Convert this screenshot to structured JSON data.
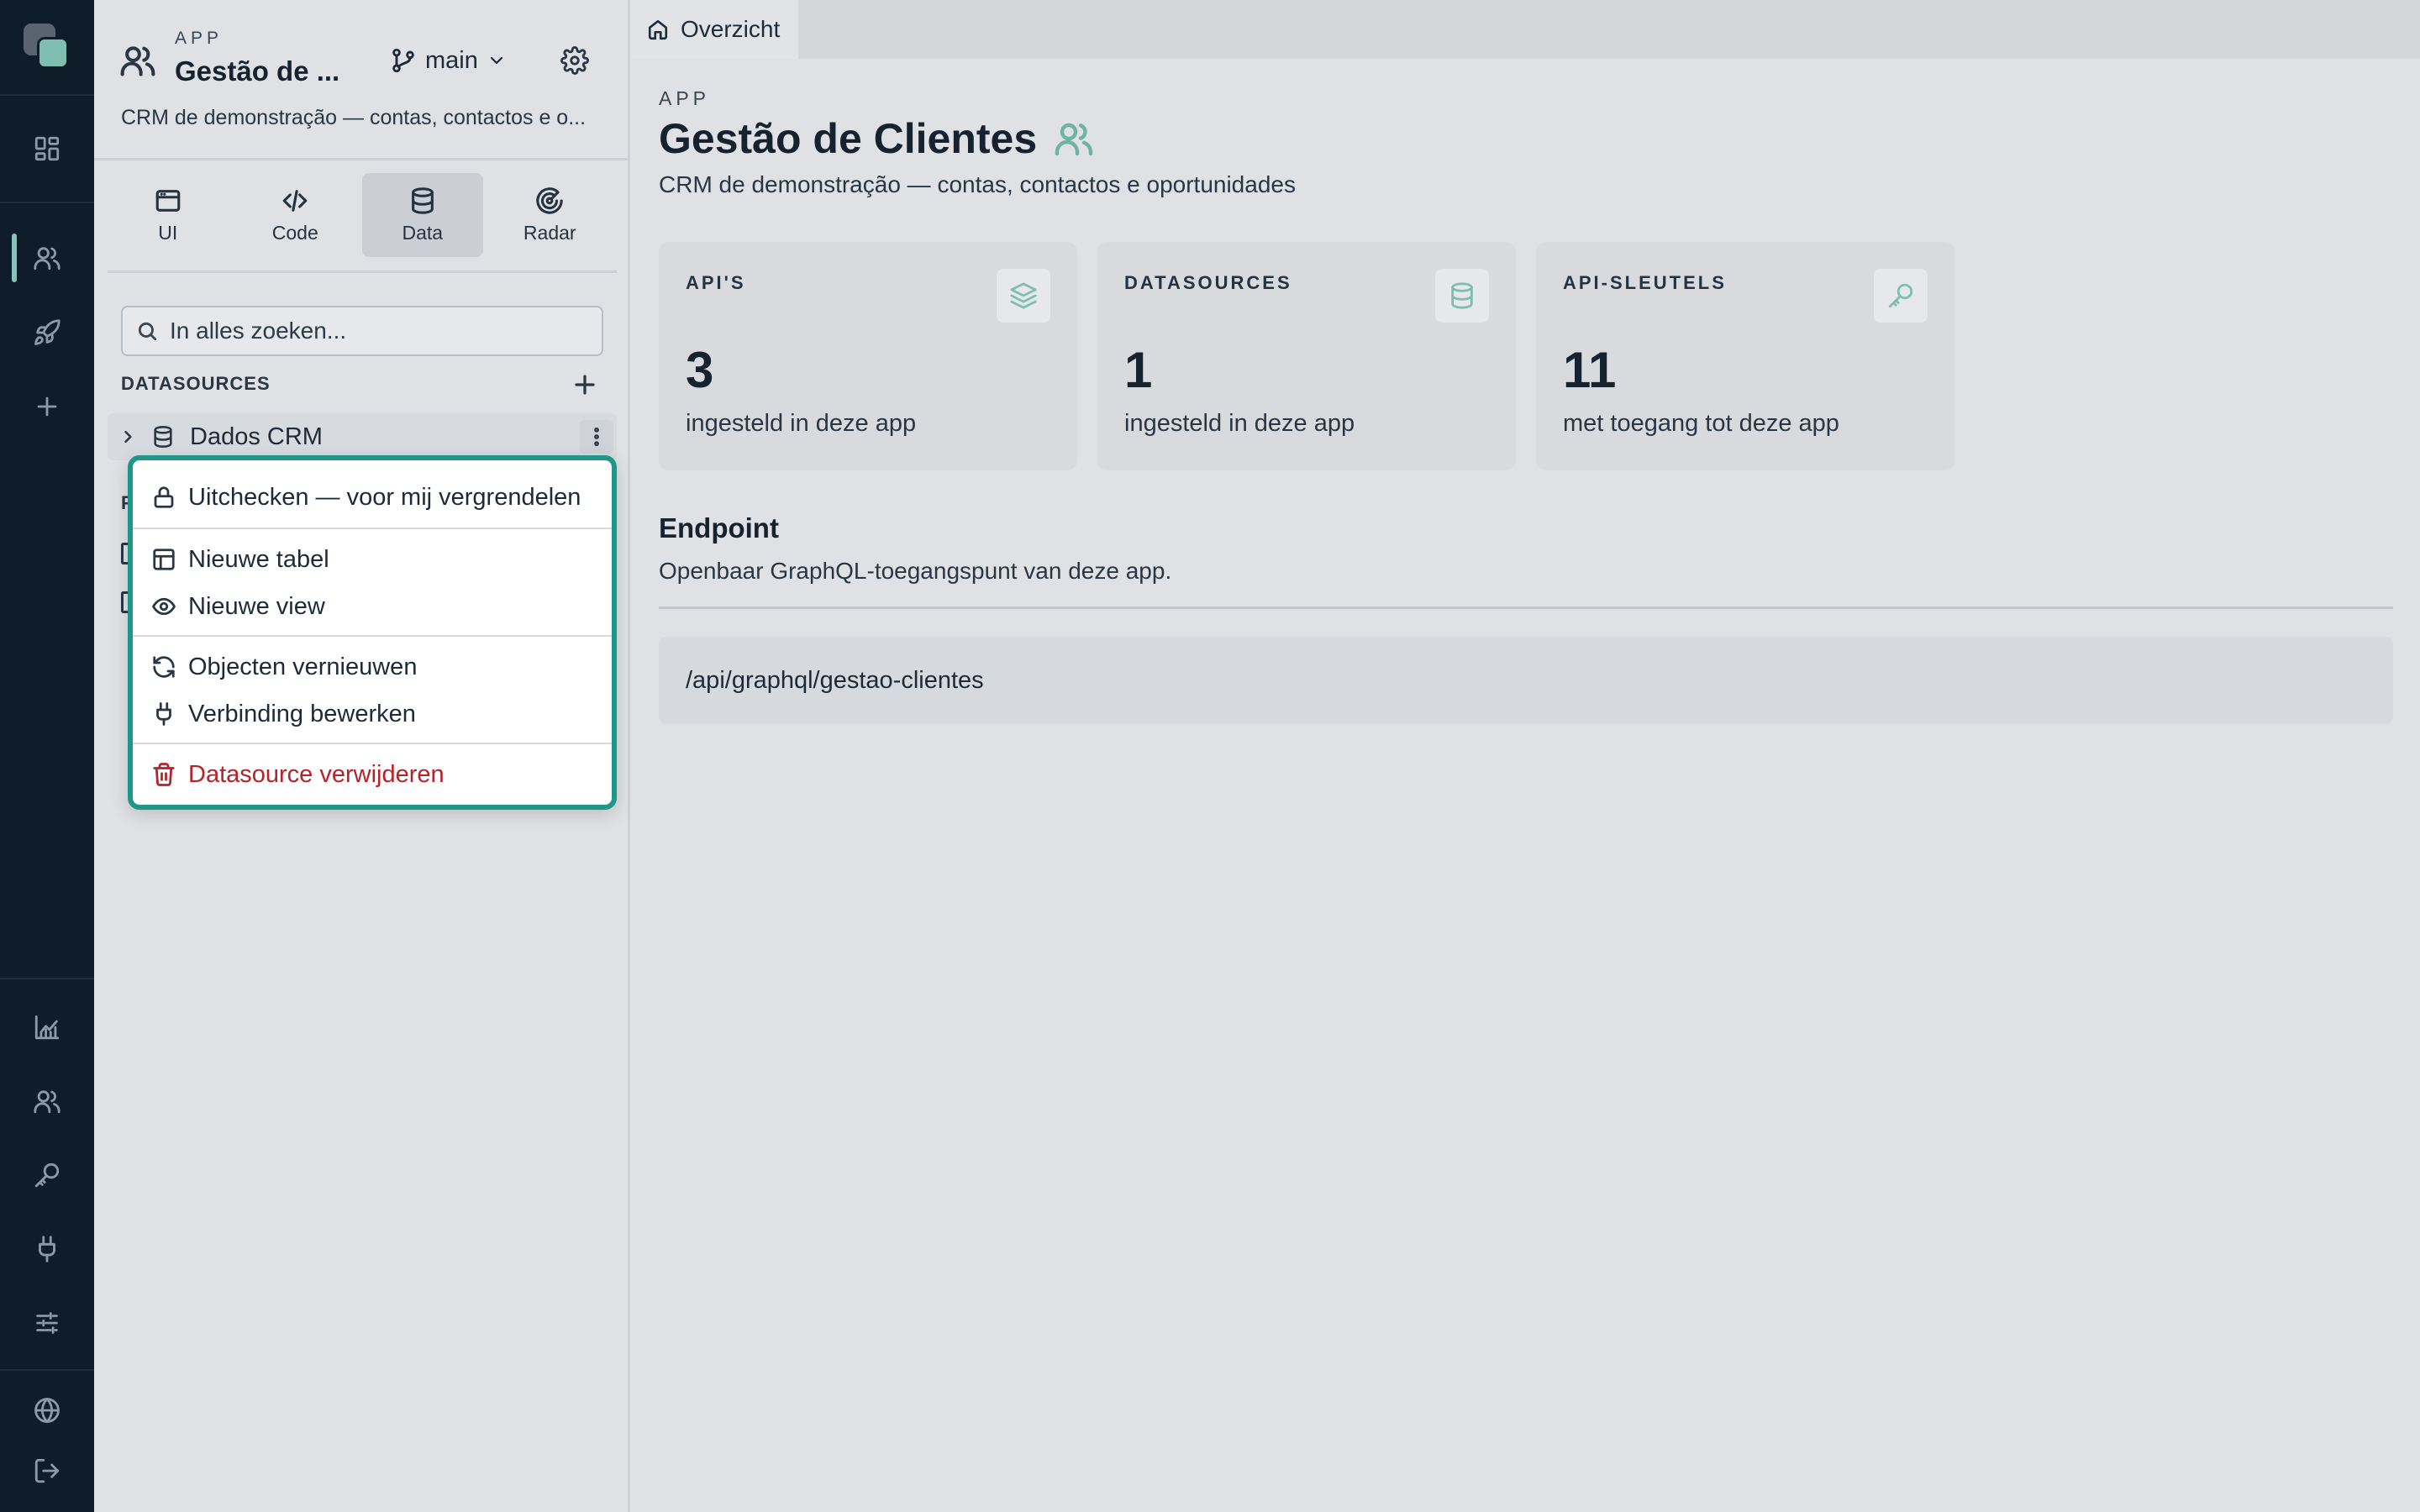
{
  "panel": {
    "kicker": "APP",
    "title": "Gestão de ...",
    "description": "CRM de demonstração — contas, contactos e o...",
    "branch": "main",
    "tabs": [
      {
        "label": "UI",
        "icon": "window-icon"
      },
      {
        "label": "Code",
        "icon": "code-icon"
      },
      {
        "label": "Data",
        "icon": "database-icon",
        "active": true
      },
      {
        "label": "Radar",
        "icon": "radar-icon"
      }
    ],
    "search_placeholder": "In alles zoeken...",
    "datasources_title": "DATASOURCES",
    "datasource_item": "Dados CRM",
    "section_peek": "P"
  },
  "menu": {
    "items": [
      {
        "label": "Uitchecken — voor mij vergrendelen",
        "icon": "lock-icon"
      },
      {
        "label": "Nieuwe tabel",
        "icon": "table-icon"
      },
      {
        "label": "Nieuwe view",
        "icon": "eye-icon"
      },
      {
        "label": "Objecten vernieuwen",
        "icon": "refresh-icon"
      },
      {
        "label": "Verbinding bewerken",
        "icon": "plug-icon"
      },
      {
        "label": "Datasource verwijderen",
        "icon": "trash-icon",
        "danger": true
      }
    ]
  },
  "main": {
    "tab": "Overzicht",
    "kicker": "APP",
    "title": "Gestão de Clientes",
    "description": "CRM de demonstração — contas, contactos e oportunidades",
    "cards": [
      {
        "label": "API'S",
        "value": "3",
        "sub": "ingesteld in deze app",
        "icon": "layers-icon"
      },
      {
        "label": "DATASOURCES",
        "value": "1",
        "sub": "ingesteld in deze app",
        "icon": "database-icon"
      },
      {
        "label": "API-SLEUTELS",
        "value": "11",
        "sub": "met toegang tot deze app",
        "icon": "key-icon"
      }
    ],
    "endpoint": {
      "title": "Endpoint",
      "description": "Openbaar GraphQL-toegangspunt van deze app.",
      "url": "/api/graphql/gestao-clientes"
    }
  },
  "colors": {
    "rail": "#0f1c2a",
    "accent": "#1e9688",
    "accent_light": "#7fbfb2",
    "danger": "#b4232a"
  }
}
